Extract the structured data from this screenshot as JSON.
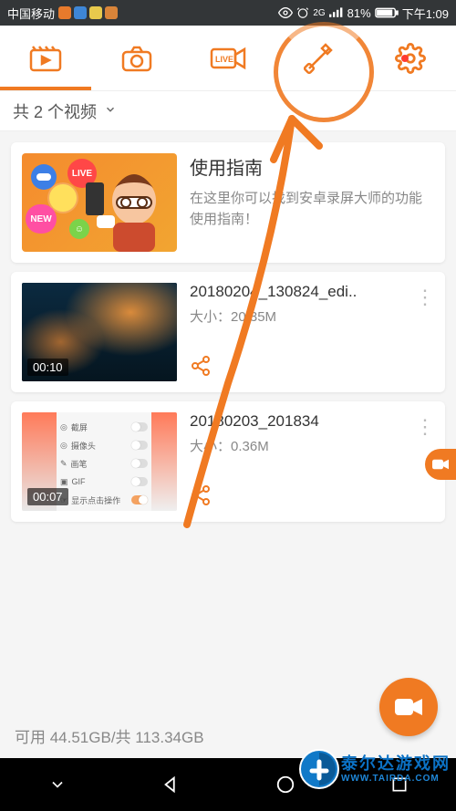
{
  "status": {
    "carrier": "中国移动",
    "network": "2G",
    "battery": "81%",
    "time": "下午1:09"
  },
  "subheader": {
    "count_text": "共 2 个视频"
  },
  "guide": {
    "title": "使用指南",
    "desc": "在这里你可以找到安卓录屏大师的功能使用指南！",
    "live_label": "LIVE",
    "new_label": "NEW"
  },
  "videos": [
    {
      "title": "20180204_130824_edi..",
      "size_label": "大小：20.35M",
      "duration": "00:10"
    },
    {
      "title": "20180203_201834",
      "size_label": "大小：0.36M",
      "duration": "00:07",
      "toggles": [
        "截屏",
        "摄像头",
        "画笔",
        "GIF",
        "显示点击操作"
      ]
    }
  ],
  "footer": {
    "storage": "可用 44.51GB/共 113.34GB"
  },
  "watermark": {
    "cn": "泰尔达游戏网",
    "en": "WWW.TAIRDA.COM"
  }
}
